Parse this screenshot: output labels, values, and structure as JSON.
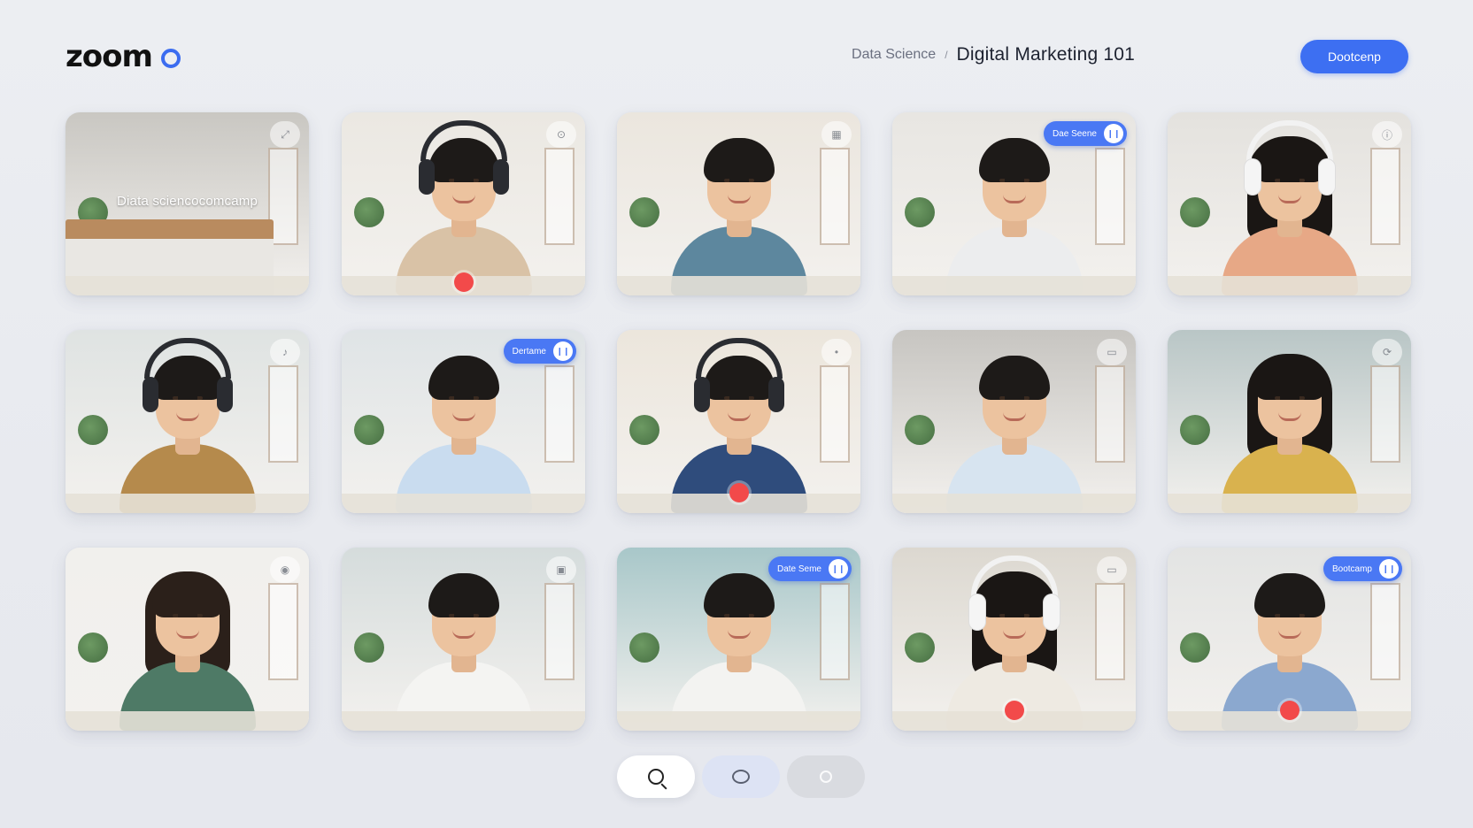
{
  "app": {
    "logo_text": "zoom"
  },
  "header": {
    "breadcrumb_parent": "Data Science",
    "breadcrumb_separator": "/",
    "meeting_title": "Digital Marketing 101",
    "action_button_label": "Dootcenp"
  },
  "colors": {
    "accent": "#3d6ff2",
    "record": "#f24a4a",
    "background": "#eceef2"
  },
  "participants": [
    {
      "caption": "Diata sciencocomcamp",
      "person": false,
      "overlay": "icon",
      "overlay_icon": "expand-icon",
      "bg": "#c9c7c2"
    },
    {
      "person": true,
      "shirt": "#d9c2a6",
      "hair": "#1d1a18",
      "headphones": "black",
      "overlay": "icon",
      "overlay_icon": "pin-icon",
      "rec": true,
      "bg": "#ebe8e2"
    },
    {
      "person": true,
      "shirt": "#5d879e",
      "hair": "#1d1a18",
      "overlay": "icon",
      "overlay_icon": "grid-icon",
      "bg": "#ebe6de"
    },
    {
      "person": true,
      "shirt": "#ecedee",
      "hair": "#1d1a18",
      "overlay": "pill",
      "pill_label": "Dae Seene",
      "bg": "#e8e6e2"
    },
    {
      "person": true,
      "shirt": "#e7a886",
      "hair": "#1a1614",
      "hair_long": true,
      "headphones": "white",
      "overlay": "icon",
      "overlay_icon": "info-icon",
      "bg": "#e4e2de"
    },
    {
      "person": true,
      "shirt": "#b58a4c",
      "hair": "#1d1a18",
      "headphones": "black",
      "overlay": "icon",
      "overlay_icon": "mic-icon",
      "bg": "#dfe3e2"
    },
    {
      "person": true,
      "shirt": "#c9dcef",
      "hair": "#1d1a18",
      "overlay": "pill",
      "pill_label": "Dertame",
      "bg": "#dfe4e6"
    },
    {
      "person": true,
      "shirt": "#2f4c7c",
      "hair": "#1d1a18",
      "headphones": "black",
      "overlay": "icon",
      "overlay_icon": "dot-icon",
      "rec": true,
      "rec_mid": true,
      "bg": "#ece6dc"
    },
    {
      "person": true,
      "shirt": "#d7e4f0",
      "hair": "#1d1a18",
      "overlay": "icon",
      "overlay_icon": "camera-icon",
      "bg": "#c7c5c1"
    },
    {
      "person": true,
      "shirt": "#d9b24e",
      "hair": "#1a1614",
      "hair_long": true,
      "overlay": "icon",
      "overlay_icon": "share-icon",
      "bg": "#b9c6c6"
    },
    {
      "person": true,
      "shirt": "#4e7a66",
      "hair": "#2b201a",
      "hair_long": true,
      "overlay": "icon",
      "overlay_icon": "video-icon",
      "bg": "#f1f0ed"
    },
    {
      "person": true,
      "shirt": "#f4f4f2",
      "hair": "#1d1a18",
      "overlay": "icon",
      "overlay_icon": "lock-icon",
      "bg": "#d5dcdc"
    },
    {
      "person": true,
      "shirt": "#f3f3f1",
      "hair": "#1d1a18",
      "overlay": "pill",
      "pill_label": "Date Seme",
      "bg": "#a8c7c9"
    },
    {
      "person": true,
      "shirt": "#eeeae2",
      "hair": "#1a1614",
      "hair_long": true,
      "headphones": "white",
      "overlay": "icon",
      "overlay_icon": "camera-icon",
      "rec": true,
      "rec_mid": true,
      "bg": "#dcd8d0"
    },
    {
      "person": true,
      "shirt": "#8ba8cf",
      "hair": "#1d1a18",
      "overlay": "pill",
      "pill_label": "Bootcamp",
      "rec": true,
      "rec_mid": true,
      "bg": "#e3e4e3"
    }
  ],
  "controls": [
    {
      "name": "search-button",
      "icon": "search-icon"
    },
    {
      "name": "chat-button",
      "icon": "chat-bubble-icon"
    },
    {
      "name": "share-button",
      "icon": "share-screen-icon"
    }
  ]
}
